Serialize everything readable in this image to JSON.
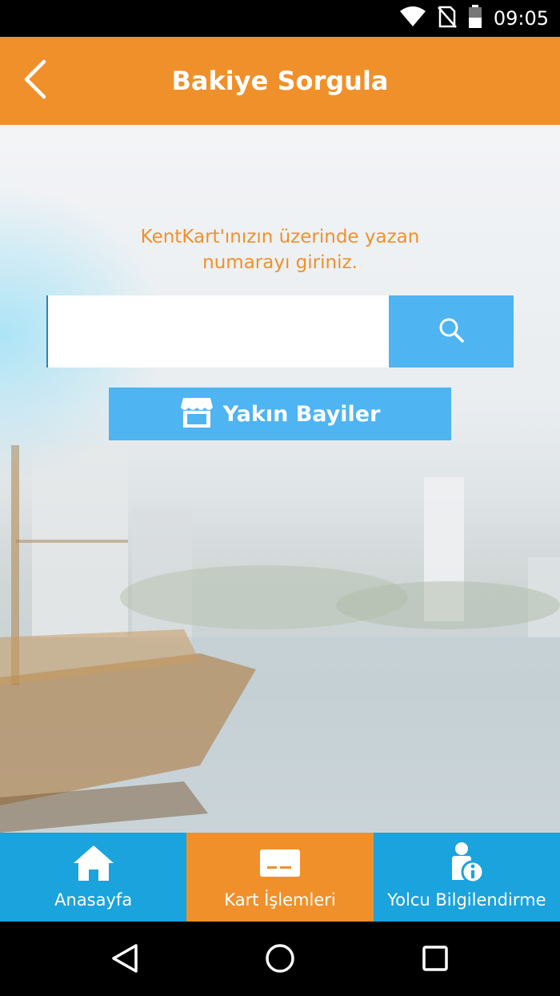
{
  "status_bar": {
    "time": "09:05",
    "icons": [
      "wifi-icon",
      "no-sim-icon",
      "battery-icon"
    ]
  },
  "app_bar": {
    "title": "Bakiye Sorgula",
    "back_icon": "chevron-left-icon"
  },
  "main": {
    "prompt_line1": "KentKart'ınızın üzerinde yazan",
    "prompt_line2": "numarayı giriniz.",
    "card_input": {
      "value": "",
      "placeholder": ""
    },
    "search_icon": "search-icon",
    "dealers_button": {
      "label": "Yakın Bayiler",
      "icon": "store-icon"
    }
  },
  "bottom_nav": {
    "items": [
      {
        "label": "Anasayfa",
        "icon": "home-icon",
        "active": false
      },
      {
        "label": "Kart İşlemleri",
        "icon": "card-icon",
        "active": true
      },
      {
        "label": "Yolcu Bilgilendirme",
        "icon": "passenger-info-icon",
        "active": false
      }
    ]
  },
  "system_nav": {
    "icons": [
      "back-triangle-icon",
      "home-circle-icon",
      "recents-square-icon"
    ]
  },
  "colors": {
    "primary_orange": "#f0902b",
    "accent_blue": "#4eb4f2",
    "nav_blue": "#1aa3dd"
  }
}
